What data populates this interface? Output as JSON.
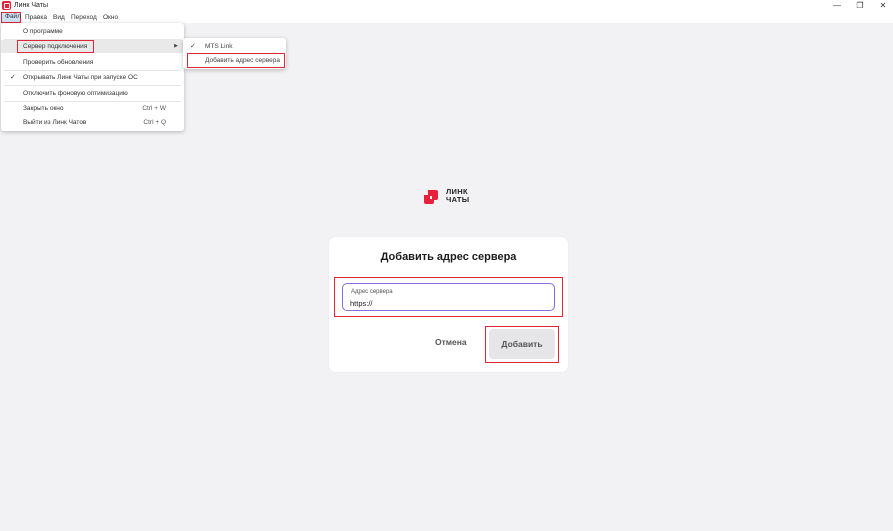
{
  "window": {
    "title": "Линк Чаты",
    "minimize": "—",
    "maximize": "❐",
    "close": "✕"
  },
  "menubar": {
    "file": "Файл",
    "edit": "Правка",
    "view": "Вид",
    "go": "Переход",
    "window": "Окно"
  },
  "file_menu": {
    "items": [
      {
        "label": "О программе"
      },
      {
        "label": "Сервер подключения"
      },
      {
        "label": "Проверить обновления"
      },
      {
        "label": "Открывать Линк Чаты при запуске ОС",
        "checked": true
      },
      {
        "label": "Отключить фоновую оптимизацию"
      },
      {
        "label": "Закрыть окно",
        "shortcut": "Ctrl + W"
      },
      {
        "label": "Выйти из Линк Чатов",
        "shortcut": "Ctrl + Q"
      }
    ],
    "check_glyph": "✓",
    "submenu_arrow": "▶"
  },
  "server_submenu": {
    "items": [
      {
        "label": "MTS Link",
        "checked": true
      },
      {
        "label": "Добавить адрес сервера"
      }
    ]
  },
  "logo": {
    "line1": "ЛИНК",
    "line2": "ЧАТЫ",
    "color": "#e8213b"
  },
  "dialog": {
    "title": "Добавить адрес сервера",
    "field_label": "Адрес сервера",
    "field_value": "https://",
    "cancel_label": "Отмена",
    "add_label": "Добавить"
  },
  "colors": {
    "highlight": "#e32636",
    "accent": "#8a6be0",
    "brand": "#e8213b"
  }
}
